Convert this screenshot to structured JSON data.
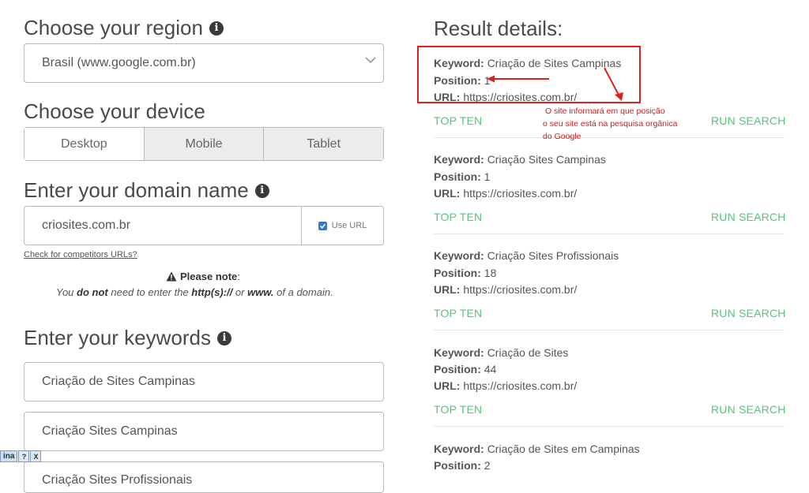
{
  "left": {
    "region": {
      "title": "Choose your region",
      "selected": "Brasil (www.google.com.br)"
    },
    "device": {
      "title": "Choose your device",
      "options": [
        "Desktop",
        "Mobile",
        "Tablet"
      ],
      "selected": "Desktop"
    },
    "domain": {
      "title": "Enter your domain name",
      "value": "criosites.com.br",
      "use_url_label": "Use URL",
      "competitors_link": "Check for competitors URLs?"
    },
    "note": {
      "title": "Please note",
      "colon": ":",
      "t1": "You ",
      "b1": "do not",
      "t2": " need to enter the ",
      "b2": "http(s)://",
      "t3": " or ",
      "b3": "www.",
      "t4": " of a domain."
    },
    "keywords": {
      "title": "Enter your keywords",
      "items": [
        "Criação de Sites Campinas",
        "Criação Sites Campinas",
        "Criação Sites Profissionais"
      ]
    }
  },
  "right": {
    "title": "Result details:",
    "labels": {
      "keyword": "Keyword:",
      "position": "Position:",
      "url": "URL:"
    },
    "actions": {
      "top_ten": "TOP TEN",
      "run_search": "RUN SEARCH"
    },
    "results": [
      {
        "keyword": "Criação de Sites Campinas",
        "position": "1",
        "url": "https://criosites.com.br/"
      },
      {
        "keyword": "Criação Sites Campinas",
        "position": "1",
        "url": "https://criosites.com.br/"
      },
      {
        "keyword": "Criação Sites Profissionais",
        "position": "18",
        "url": "https://criosites.com.br/"
      },
      {
        "keyword": "Criação de Sites",
        "position": "44",
        "url": "https://criosites.com.br/"
      },
      {
        "keyword": "Criação de Sites em Campinas",
        "position": "2",
        "url": ""
      }
    ]
  },
  "annotation": {
    "lines": [
      "O site informará em que posição",
      "o seu site está na pesquisa orgânica",
      "do Google"
    ],
    "color": "#d01818"
  },
  "toolbar": {
    "label": "ina",
    "help": "?",
    "close": "X"
  },
  "colors": {
    "accent_green": "#59c27b",
    "annotation_red": "#e02020",
    "checkbox_blue": "#2b7bd6"
  }
}
